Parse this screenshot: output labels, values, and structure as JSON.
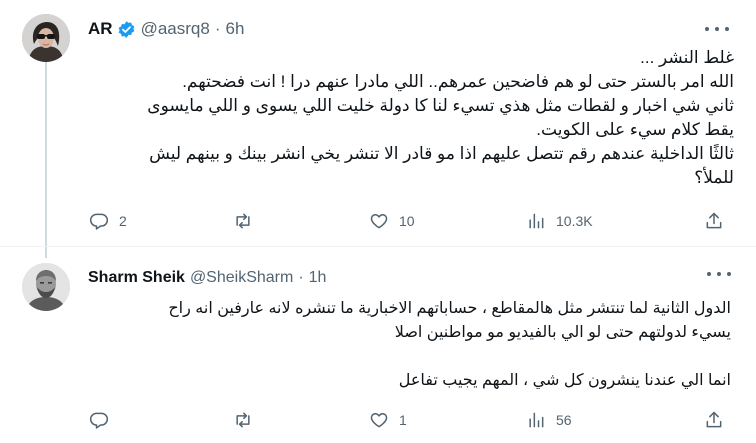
{
  "tweets": [
    {
      "display_name": "AR",
      "handle": "@aasrq8",
      "separator": "·",
      "time": "6h",
      "verified": true,
      "lines": [
        "غلط النشر ...",
        "الله امر بالستر حتى لو هم فاضحين عمرهم.. اللي مادرا عنهم درا ! انت فضحتهم.",
        "ثاني شي اخبار و لقطات مثل هذي تسيء لنا كا دولة خليت اللي يسوى و اللي مايسوى",
        "يقط كلام سيء على الكويت.",
        "ثالثًا الداخلية عندهم رقم تتصل عليهم اذا مو قادر الا تنشر يخي انشر بينك و بينهم ليش",
        "للملأ؟"
      ],
      "actions": {
        "reply_count": "2",
        "retweet_count": "",
        "like_count": "10",
        "views_count": "10.3K"
      }
    },
    {
      "display_name": "Sharm Sheik",
      "handle": "@SheikSharm",
      "separator": "·",
      "time": "1h",
      "verified": false,
      "lines": [
        "الدول الثانية لما تنتشر مثل هالمقاطع ، حساباتهم الاخبارية ما تنشره لانه عارفين انه راح",
        "يسيء لدولتهم حتى لو الي بالفيديو مو مواطنين اصلا",
        "",
        "انما الي عندنا ينشرون كل شي ، المهم يجيب تفاعل"
      ],
      "actions": {
        "reply_count": "",
        "retweet_count": "",
        "like_count": "1",
        "views_count": "56"
      }
    }
  ],
  "icons": [
    "reply-icon",
    "retweet-icon",
    "like-icon",
    "views-icon",
    "share-icon",
    "more-icon",
    "verified-badge-icon"
  ],
  "colors": {
    "text_primary": "#0f1419",
    "text_secondary": "#536471",
    "verified_blue": "#1d9bf0",
    "thread_line": "#cfd9de",
    "background": "#ffffff"
  }
}
